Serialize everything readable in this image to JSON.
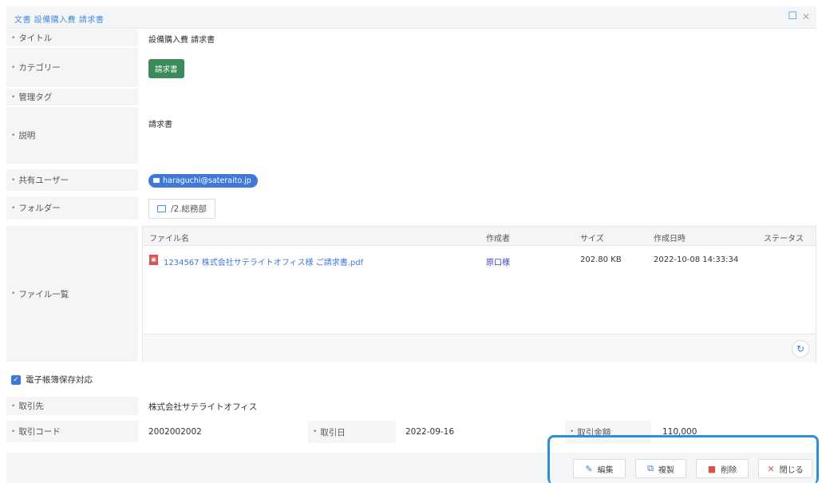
{
  "header": {
    "breadcrumb": "文書 設備購入費 請求書",
    "maximize_icon": "maximize-icon",
    "close_icon": "close-icon"
  },
  "fields": {
    "title_label": "タイトル",
    "title_value": "設備購入費 請求書",
    "category_label": "カテゴリー",
    "category_value": "請求書",
    "tag_label": "管理タグ",
    "memo_label": "説明",
    "memo_value": "請求書",
    "shared_label": "共有ユーザー",
    "shared_value": "haraguchi@sateraito.jp",
    "folder_label": "フォルダー",
    "folder_value": "/2.総務部",
    "files_label": "ファイル一覧"
  },
  "file_table": {
    "headers": [
      "ファイル名",
      "作成者",
      "サイズ",
      "作成日時",
      "ステータス"
    ],
    "rows": [
      {
        "name": "1234567 株式会社サテライトオフィス様 ご請求書.pdf",
        "author": "原口様",
        "size": "202.80 KB",
        "created": "2022-10-08 14:33:34",
        "status": ""
      }
    ]
  },
  "ebook": {
    "checkbox_label": "電子帳簿保存対応",
    "checked": true
  },
  "transaction": {
    "partner_label": "取引先",
    "partner_value": "株式会社サテライトオフィス",
    "code_label": "取引コード",
    "code_value": "2002002002",
    "date_label": "取引日",
    "date_value": "2022-09-16",
    "amount_label": "取引金額",
    "amount_value": "110,000"
  },
  "footer": {
    "edit_label": "編集",
    "copy_label": "複製",
    "delete_label": "削除",
    "close_label": "閉じる"
  },
  "colors": {
    "accent": "#3f78d6",
    "category_badge": "#3b8a5a",
    "danger": "#d9534f",
    "highlight": "#2b8fe0"
  }
}
